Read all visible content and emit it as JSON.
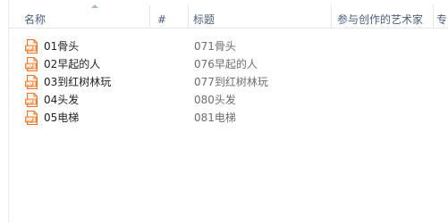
{
  "header": {
    "columns": [
      {
        "label": "名称"
      },
      {
        "label": "#"
      },
      {
        "label": "标题"
      },
      {
        "label": "参与创作的艺术家"
      },
      {
        "label": "专"
      }
    ]
  },
  "file_icon": {
    "name": "mp3-audio-file-icon",
    "color": "#e8722a"
  },
  "files": [
    {
      "name": "01骨头",
      "title": "071骨头"
    },
    {
      "name": "02早起的人",
      "title": "076早起的人"
    },
    {
      "name": "03到红树林玩",
      "title": "077到红树林玩"
    },
    {
      "name": "04头发",
      "title": "080头发"
    },
    {
      "name": "05电梯",
      "title": "081电梯"
    }
  ]
}
